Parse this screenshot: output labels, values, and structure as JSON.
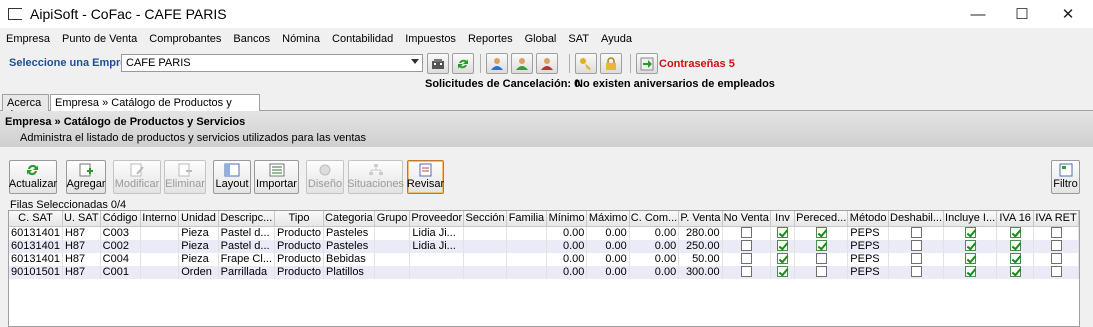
{
  "window": {
    "title": "AipiSoft - CoFac - CAFE PARIS",
    "minimize": "—",
    "maximize": "☐",
    "close": "✕"
  },
  "menu": [
    "Empresa",
    "Punto de Venta",
    "Comprobantes",
    "Bancos",
    "Nómina",
    "Contabilidad",
    "Impuestos",
    "Reportes",
    "Global",
    "SAT",
    "Ayuda"
  ],
  "company": {
    "label": "Seleccione una Empresa",
    "selected": "CAFE PARIS",
    "passwords": "Contraseñas 5"
  },
  "status": {
    "cancel": "Solicitudes de Cancelación: 0",
    "birthdays": "No existen aniversarios de empleados"
  },
  "tabs": [
    {
      "label": "Acerca de"
    },
    {
      "label": "Empresa » Catálogo de Productos y Servicios",
      "close": "✕"
    }
  ],
  "panel": {
    "title": "Empresa » Catálogo de Productos y Servicios",
    "description": "Administra el listado de productos y servicios utilizados para las ventas"
  },
  "actions": {
    "actualizar": "Actualizar",
    "agregar": "Agregar",
    "modificar": "Modificar",
    "eliminar": "Eliminar",
    "layout": "Layout",
    "importar": "Importar",
    "diseno": "Diseño",
    "situaciones": "Situaciones",
    "revisar": "Revisar",
    "filtro": "Filtro"
  },
  "selected_rows": "Filas Seleccionadas 0/4",
  "columns": [
    "C. SAT",
    "U. SAT",
    "Código",
    "Interno",
    "Unidad",
    "Descripc...",
    "Tipo",
    "Categoria",
    "Grupo",
    "Proveedor",
    "Sección",
    "Familia",
    "Mínimo",
    "Máximo",
    "C. Com...",
    "P. Venta",
    "No Venta",
    "Inv",
    "Pereced...",
    "Método",
    "Deshabil...",
    "Incluye I...",
    "IVA 16",
    "IVA RET"
  ],
  "rows": [
    {
      "csat": "60131401",
      "usat": "H87",
      "codigo": "C003",
      "interno": "",
      "unidad": "Pieza",
      "desc": "Pastel d...",
      "tipo": "Producto",
      "categoria": "Pasteles",
      "grupo": "",
      "proveedor": "Lidia Ji...",
      "seccion": "",
      "familia": "",
      "minimo": "0.00",
      "maximo": "0.00",
      "ccom": "0.00",
      "pventa": "280.00",
      "noventa": false,
      "inv": true,
      "perecedero": true,
      "metodo": "PEPS",
      "deshab": false,
      "incluye": true,
      "iva16": true,
      "ivaret": false
    },
    {
      "csat": "60131401",
      "usat": "H87",
      "codigo": "C002",
      "interno": "",
      "unidad": "Pieza",
      "desc": "Pastel d...",
      "tipo": "Producto",
      "categoria": "Pasteles",
      "grupo": "",
      "proveedor": "Lidia Ji...",
      "seccion": "",
      "familia": "",
      "minimo": "0.00",
      "maximo": "0.00",
      "ccom": "0.00",
      "pventa": "250.00",
      "noventa": false,
      "inv": true,
      "perecedero": true,
      "metodo": "PEPS",
      "deshab": false,
      "incluye": true,
      "iva16": true,
      "ivaret": false
    },
    {
      "csat": "60131401",
      "usat": "H87",
      "codigo": "C004",
      "interno": "",
      "unidad": "Pieza",
      "desc": "Frape Cl...",
      "tipo": "Producto",
      "categoria": "Bebidas",
      "grupo": "",
      "proveedor": "",
      "seccion": "",
      "familia": "",
      "minimo": "0.00",
      "maximo": "0.00",
      "ccom": "0.00",
      "pventa": "50.00",
      "noventa": false,
      "inv": true,
      "perecedero": false,
      "metodo": "PEPS",
      "deshab": false,
      "incluye": true,
      "iva16": true,
      "ivaret": false
    },
    {
      "csat": "90101501",
      "usat": "H87",
      "codigo": "C001",
      "interno": "",
      "unidad": "Orden",
      "desc": "Parrillada",
      "tipo": "Producto",
      "categoria": "Platillos",
      "grupo": "",
      "proveedor": "",
      "seccion": "",
      "familia": "",
      "minimo": "0.00",
      "maximo": "0.00",
      "ccom": "0.00",
      "pventa": "300.00",
      "noventa": false,
      "inv": true,
      "perecedero": false,
      "metodo": "PEPS",
      "deshab": false,
      "incluye": true,
      "iva16": true,
      "ivaret": false
    }
  ]
}
